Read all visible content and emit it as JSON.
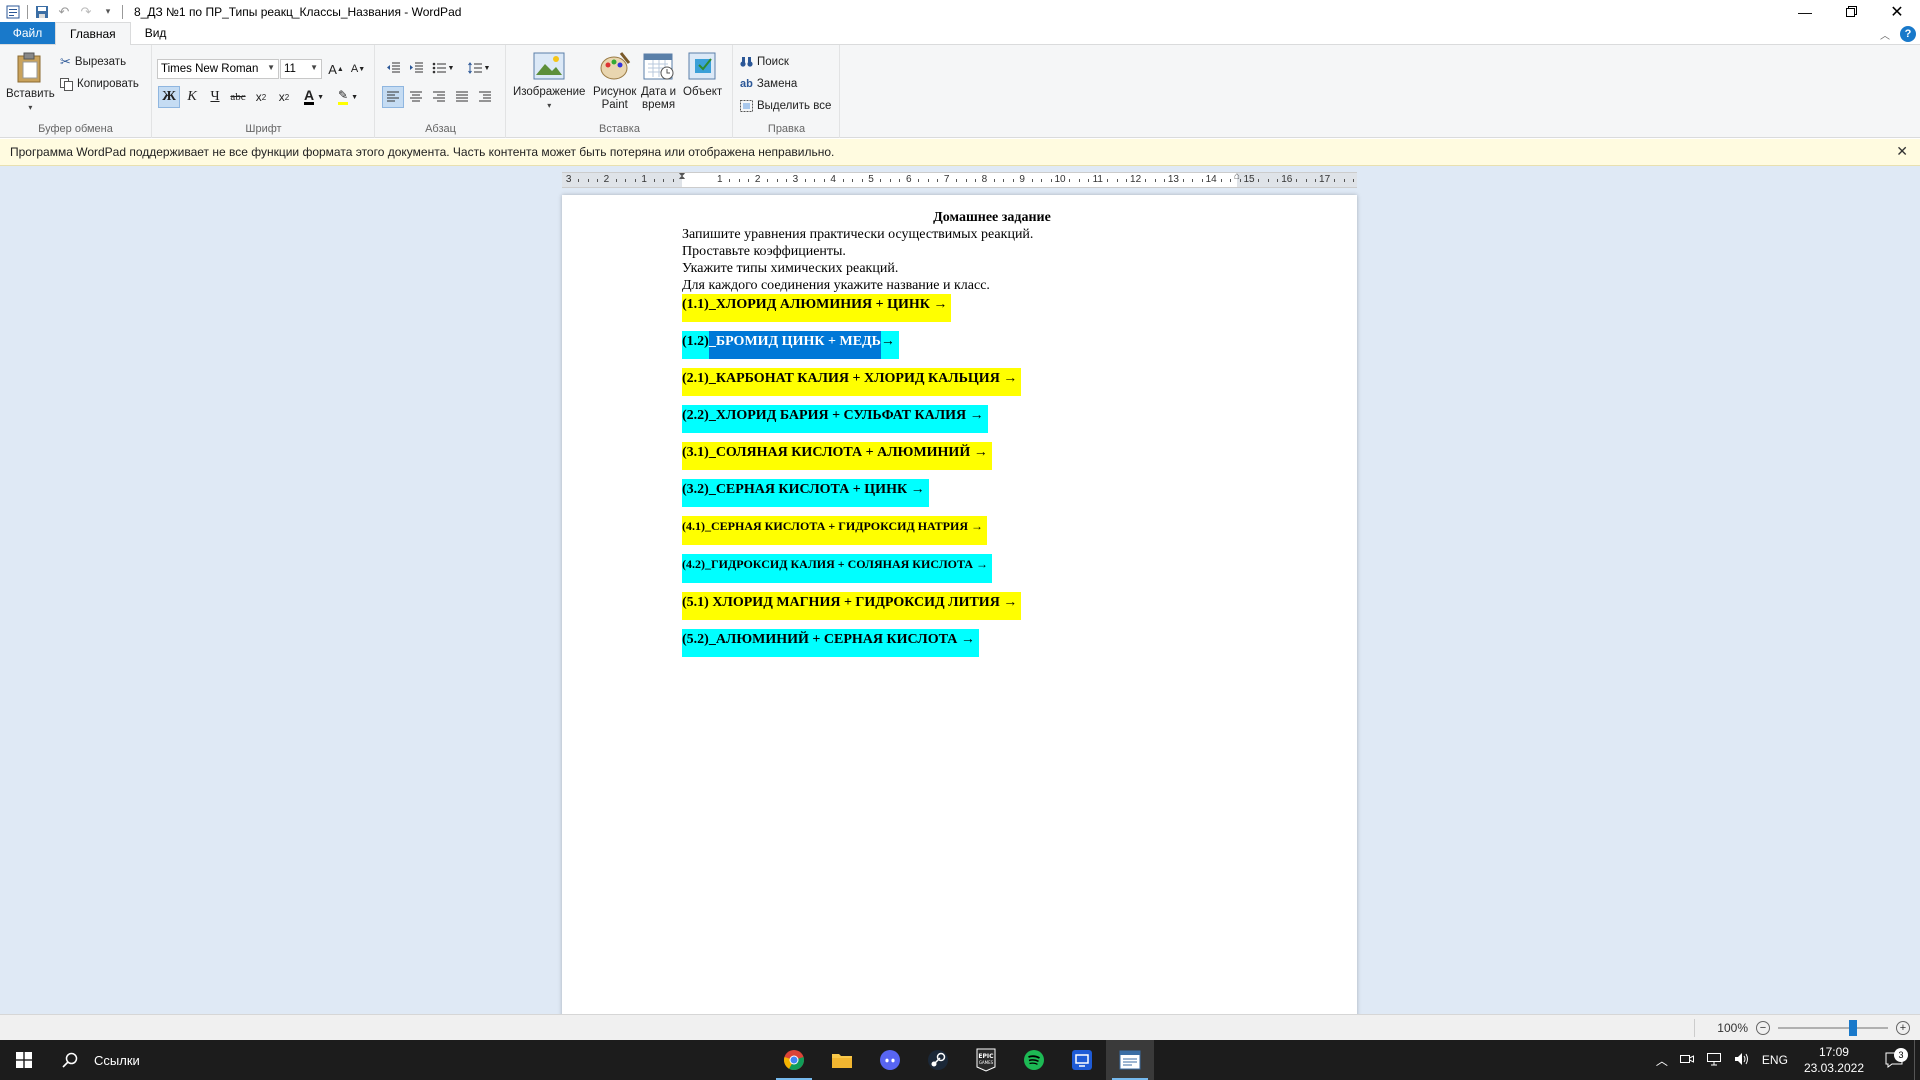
{
  "window": {
    "title": "8_ДЗ №1 по ПР_Типы реакц_Классы_Названия - WordPad"
  },
  "tabs": {
    "file": "Файл",
    "home": "Главная",
    "view": "Вид"
  },
  "ribbon": {
    "clipboard": {
      "label": "Буфер обмена",
      "paste": "Вставить",
      "cut": "Вырезать",
      "copy": "Копировать"
    },
    "font": {
      "label": "Шрифт",
      "family": "Times New Roman",
      "size": "11",
      "bold": "Ж",
      "italic": "К",
      "underline": "Ч",
      "strike": "abc"
    },
    "paragraph": {
      "label": "Абзац"
    },
    "insert": {
      "label": "Вставка",
      "image": "Изображение",
      "paint_line1": "Рисунок",
      "paint_line2": "Paint",
      "datetime_line1": "Дата и",
      "datetime_line2": "время",
      "object": "Объект"
    },
    "editing": {
      "label": "Правка",
      "find": "Поиск",
      "replace": "Замена",
      "select_all": "Выделить все"
    }
  },
  "infobar": {
    "message": "Программа WordPad поддерживает не все функции формата этого документа. Часть контента может быть потеряна или отображена неправильно."
  },
  "ruler": {
    "numbers": [
      "3",
      "2",
      "1",
      "1",
      "2",
      "3",
      "4",
      "5",
      "6",
      "7",
      "8",
      "9",
      "10",
      "11",
      "12",
      "13",
      "14",
      "15",
      "16",
      "17"
    ]
  },
  "document": {
    "title": "Домашнее задание",
    "instructions": [
      "Запишите уравнения практически осуществимых реакций.",
      "Проставьте коэффициенты.",
      "Укажите типы химических реакций.",
      "Для каждого соединения укажите название и класс."
    ],
    "reactions": [
      {
        "text": "(1.1)_ХЛОРИД АЛЮМИНИЯ + ЦИНК →",
        "color": "#ffff00"
      },
      {
        "text": "(1.2)_БРОМИД ЦИНК + МЕДЬ →",
        "color": "#00ffff"
      },
      {
        "text": "(2.1)_КАРБОНАТ КАЛИЯ + ХЛОРИД КАЛЬЦИЯ →",
        "color": "#ffff00"
      },
      {
        "text": "(2.2)_ХЛОРИД БАРИЯ + СУЛЬФАТ КАЛИЯ →",
        "color": "#00ffff"
      },
      {
        "text": "(3.1)_СОЛЯНАЯ КИСЛОТА + АЛЮМИНИЙ →",
        "color": "#ffff00"
      },
      {
        "text": "(3.2)_СЕРНАЯ КИСЛОТА + ЦИНК →",
        "color": "#00ffff"
      },
      {
        "text": "(4.1)_СЕРНАЯ КИСЛОТА + ГИДРОКСИД НАТРИЯ →",
        "color": "#ffff00"
      },
      {
        "text": "(4.2)_ГИДРОКСИД КАЛИЯ + СОЛЯНАЯ КИСЛОТА →",
        "color": "#00ffff"
      },
      {
        "text": "(5.1) ХЛОРИД МАГНИЯ + ГИДРОКСИД ЛИТИЯ →",
        "color": "#ffff00"
      },
      {
        "text": "(5.2)_АЛЮМИНИЙ + СЕРНАЯ КИСЛОТА →",
        "color": "#00ffff"
      }
    ],
    "selected_part": "_БРОМИД ЦИНК + МЕДЬ",
    "selected_prefix": "(1.2)",
    "selected_suffix": " →"
  },
  "statusbar": {
    "zoom": "100%",
    "zoom_level": 1.0
  },
  "taskbar": {
    "search_label": "Ссылки",
    "apps": [
      "chrome-icon",
      "folder-icon",
      "discord-icon",
      "steam-icon",
      "epic-games-icon",
      "spotify-icon",
      "remote-app-icon",
      "wordpad-icon"
    ],
    "language": "ENG",
    "time": "17:09",
    "date": "23.03.2022",
    "notifications": "3"
  }
}
